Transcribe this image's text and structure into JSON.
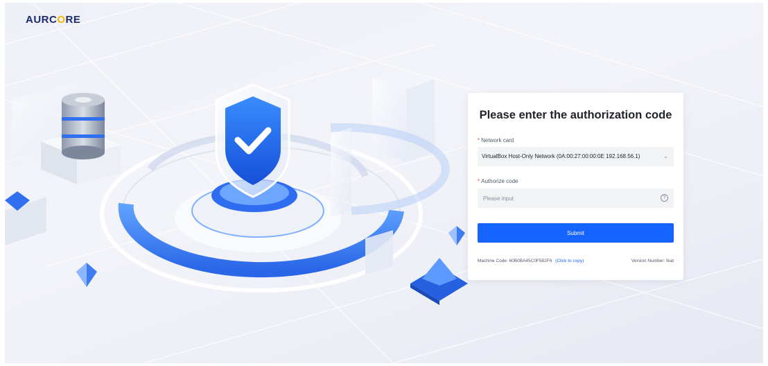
{
  "brand": {
    "logo_prefix": "AURC",
    "logo_o": "O",
    "logo_suffix": "RE"
  },
  "form": {
    "title": "Please enter the authorization code",
    "network_card": {
      "required_mark": "*",
      "label": "Network card",
      "value": "VirtualBox Host-Only Network (0A:00:27:00:00:0E 192.168.56.1)"
    },
    "authorize_code": {
      "required_mark": "*",
      "label": "Authorize code",
      "placeholder": "Please input",
      "value": ""
    },
    "submit_label": "Submit"
  },
  "footer": {
    "machine_code_label": "Machine Code:",
    "machine_code": "60B0BA45C0F582F6",
    "copy_link": "(Click to copy)",
    "version_label": "Version Number:",
    "version": "feat"
  },
  "icons": {
    "select_arrow": "chevron-down-icon",
    "help": "question-circle-icon",
    "hero": "shield-check-icon"
  },
  "colors": {
    "primary": "#1664ff",
    "required": "#f53f3f",
    "logo_text": "#1b2a6b",
    "logo_accent": "#f5b400"
  }
}
